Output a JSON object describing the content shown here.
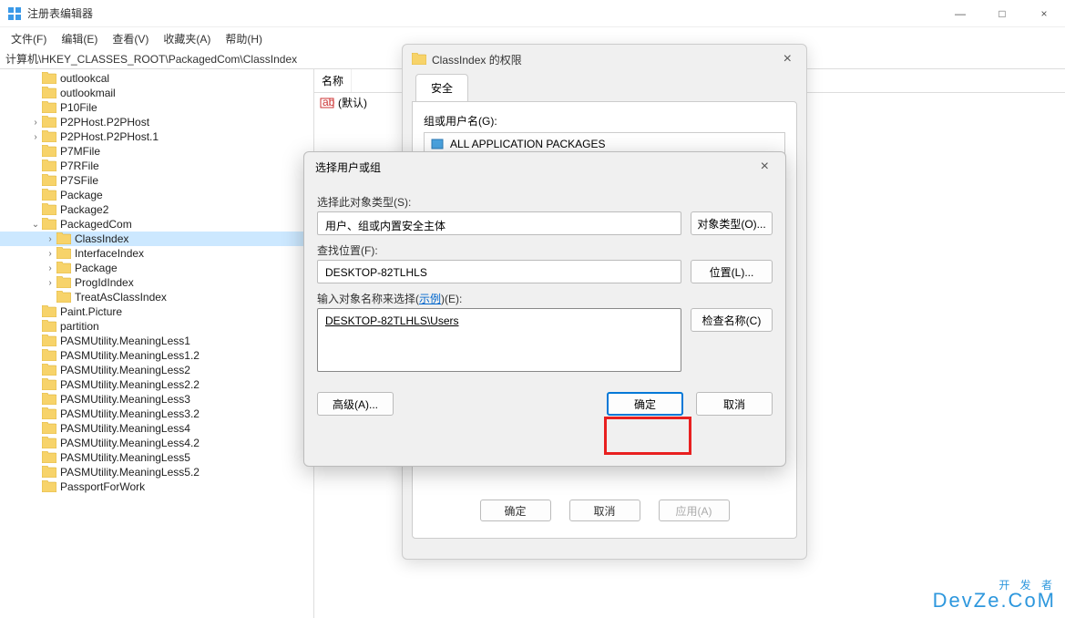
{
  "window": {
    "title": "注册表编辑器",
    "min": "—",
    "max": "□",
    "close": "×"
  },
  "menu": {
    "file": "文件(F)",
    "edit": "编辑(E)",
    "view": "查看(V)",
    "favorites": "收藏夹(A)",
    "help": "帮助(H)"
  },
  "address": "计算机\\HKEY_CLASSES_ROOT\\PackagedCom\\ClassIndex",
  "tree": [
    {
      "indent": 2,
      "caret": "",
      "label": "outlookcal"
    },
    {
      "indent": 2,
      "caret": "",
      "label": "outlookmail"
    },
    {
      "indent": 2,
      "caret": "",
      "label": "P10File"
    },
    {
      "indent": 2,
      "caret": ">",
      "label": "P2PHost.P2PHost"
    },
    {
      "indent": 2,
      "caret": ">",
      "label": "P2PHost.P2PHost.1"
    },
    {
      "indent": 2,
      "caret": "",
      "label": "P7MFile"
    },
    {
      "indent": 2,
      "caret": "",
      "label": "P7RFile"
    },
    {
      "indent": 2,
      "caret": "",
      "label": "P7SFile"
    },
    {
      "indent": 2,
      "caret": "",
      "label": "Package"
    },
    {
      "indent": 2,
      "caret": "",
      "label": "Package2"
    },
    {
      "indent": 2,
      "caret": "v",
      "label": "PackagedCom"
    },
    {
      "indent": 3,
      "caret": ">",
      "label": "ClassIndex",
      "selected": true
    },
    {
      "indent": 3,
      "caret": ">",
      "label": "InterfaceIndex"
    },
    {
      "indent": 3,
      "caret": ">",
      "label": "Package"
    },
    {
      "indent": 3,
      "caret": ">",
      "label": "ProgIdIndex"
    },
    {
      "indent": 3,
      "caret": "",
      "label": "TreatAsClassIndex"
    },
    {
      "indent": 2,
      "caret": "",
      "label": "Paint.Picture"
    },
    {
      "indent": 2,
      "caret": "",
      "label": "partition"
    },
    {
      "indent": 2,
      "caret": "",
      "label": "PASMUtility.MeaningLess1"
    },
    {
      "indent": 2,
      "caret": "",
      "label": "PASMUtility.MeaningLess1.2"
    },
    {
      "indent": 2,
      "caret": "",
      "label": "PASMUtility.MeaningLess2"
    },
    {
      "indent": 2,
      "caret": "",
      "label": "PASMUtility.MeaningLess2.2"
    },
    {
      "indent": 2,
      "caret": "",
      "label": "PASMUtility.MeaningLess3"
    },
    {
      "indent": 2,
      "caret": "",
      "label": "PASMUtility.MeaningLess3.2"
    },
    {
      "indent": 2,
      "caret": "",
      "label": "PASMUtility.MeaningLess4"
    },
    {
      "indent": 2,
      "caret": "",
      "label": "PASMUtility.MeaningLess4.2"
    },
    {
      "indent": 2,
      "caret": "",
      "label": "PASMUtility.MeaningLess5"
    },
    {
      "indent": 2,
      "caret": "",
      "label": "PASMUtility.MeaningLess5.2"
    },
    {
      "indent": 2,
      "caret": "",
      "label": "PassportForWork"
    }
  ],
  "values": {
    "header_name": "名称",
    "default_name": "(默认)"
  },
  "perm": {
    "title": "ClassIndex 的权限",
    "tab_security": "安全",
    "group_label": "组或用户名(G):",
    "list_item1": "ALL APPLICATION PACKAGES",
    "ok": "确定",
    "cancel": "取消",
    "apply": "应用(A)"
  },
  "select": {
    "title": "选择用户或组",
    "close": "×",
    "object_type_label": "选择此对象类型(S):",
    "object_type_value": "用户、组或内置安全主体",
    "object_type_btn": "对象类型(O)...",
    "location_label": "查找位置(F):",
    "location_value": "DESKTOP-82TLHLS",
    "location_btn": "位置(L)...",
    "enter_name_prefix": "输入对象名称来选择(",
    "enter_name_link": "示例",
    "enter_name_suffix": ")(E):",
    "entered_value": "DESKTOP-82TLHLS\\Users",
    "check_names_btn": "检查名称(C)",
    "advanced_btn": "高级(A)...",
    "ok": "确定",
    "cancel": "取消"
  },
  "watermark": {
    "line1": "开 发 者",
    "line2": "DevZe.CoM"
  }
}
